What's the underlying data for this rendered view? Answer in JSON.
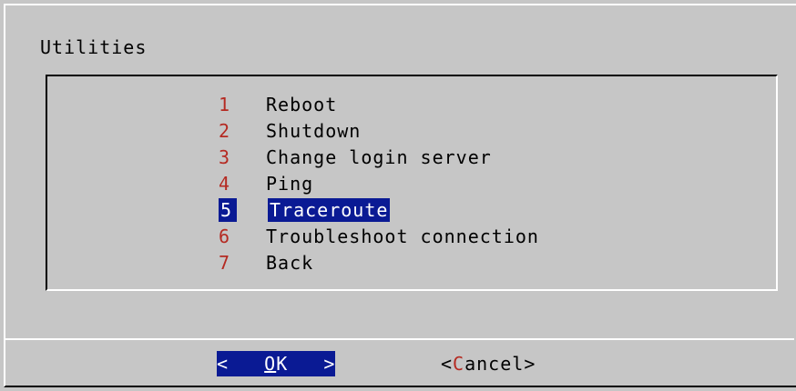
{
  "dialog": {
    "title": "Utilities"
  },
  "menu": {
    "items": [
      {
        "number": "1",
        "label": "Reboot",
        "selected": false
      },
      {
        "number": "2",
        "label": "Shutdown",
        "selected": false
      },
      {
        "number": "3",
        "label": "Change login server",
        "selected": false
      },
      {
        "number": "4",
        "label": "Ping",
        "selected": false
      },
      {
        "number": "5",
        "label": "Traceroute",
        "selected": true
      },
      {
        "number": "6",
        "label": "Troubleshoot connection",
        "selected": false
      },
      {
        "number": "7",
        "label": "Back",
        "selected": false
      }
    ]
  },
  "buttons": {
    "ok": {
      "left": "<",
      "hot": "O",
      "rest": "K",
      "right": ">"
    },
    "cancel": {
      "left": "<",
      "hot": "C",
      "rest": "ancel",
      "right": ">"
    }
  },
  "colors": {
    "background": "#c6c6c6",
    "selection": "#0a1a94",
    "hotkey": "#b52a22"
  }
}
